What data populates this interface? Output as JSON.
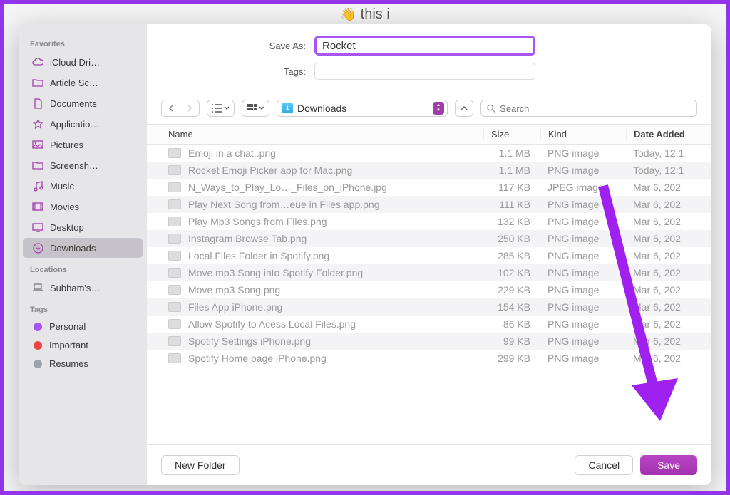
{
  "window_title": "this i",
  "window_emoji": "👋",
  "dialog": {
    "save_as_label": "Save As:",
    "save_as_value": "Rocket",
    "tags_label": "Tags:",
    "tags_value": ""
  },
  "sidebar": {
    "favorites_header": "Favorites",
    "favorites": [
      {
        "label": "iCloud Dri…",
        "icon": "cloud"
      },
      {
        "label": "Article Sc…",
        "icon": "folder"
      },
      {
        "label": "Documents",
        "icon": "document"
      },
      {
        "label": "Applicatio…",
        "icon": "apps"
      },
      {
        "label": "Pictures",
        "icon": "pictures"
      },
      {
        "label": "Screensh…",
        "icon": "folder"
      },
      {
        "label": "Music",
        "icon": "music"
      },
      {
        "label": "Movies",
        "icon": "movies"
      },
      {
        "label": "Desktop",
        "icon": "desktop"
      },
      {
        "label": "Downloads",
        "icon": "download",
        "selected": true
      }
    ],
    "locations_header": "Locations",
    "locations": [
      {
        "label": "Subham's…",
        "icon": "laptop"
      }
    ],
    "tags_header": "Tags",
    "tags": [
      {
        "label": "Personal",
        "color": "#a855f7"
      },
      {
        "label": "Important",
        "color": "#ef4444"
      },
      {
        "label": "Resumes",
        "color": "#9ca3af"
      }
    ]
  },
  "toolbar": {
    "location_label": "Downloads",
    "search_placeholder": "Search"
  },
  "columns": {
    "name": "Name",
    "size": "Size",
    "kind": "Kind",
    "date": "Date Added"
  },
  "files": [
    {
      "name": "Emoji in a chat..png",
      "size": "1.1 MB",
      "kind": "PNG image",
      "date": "Today, 12:1"
    },
    {
      "name": "Rocket Emoji Picker app for Mac.png",
      "size": "1.1 MB",
      "kind": "PNG image",
      "date": "Today, 12:1"
    },
    {
      "name": "N_Ways_to_Play_Lo…_Files_on_iPhone.jpg",
      "size": "117 KB",
      "kind": "JPEG image",
      "date": "Mar 6, 202"
    },
    {
      "name": "Play Next Song from…eue in Files app.png",
      "size": "111 KB",
      "kind": "PNG image",
      "date": "Mar 6, 202"
    },
    {
      "name": "Play Mp3 Songs from Files.png",
      "size": "132 KB",
      "kind": "PNG image",
      "date": "Mar 6, 202"
    },
    {
      "name": "Instagram Browse Tab.png",
      "size": "250 KB",
      "kind": "PNG image",
      "date": "Mar 6, 202"
    },
    {
      "name": "Local Files Folder in Spotify.png",
      "size": "285 KB",
      "kind": "PNG image",
      "date": "Mar 6, 202"
    },
    {
      "name": "Move mp3 Song into Spotify Folder.png",
      "size": "102 KB",
      "kind": "PNG image",
      "date": "Mar 6, 202"
    },
    {
      "name": "Move mp3 Song.png",
      "size": "229 KB",
      "kind": "PNG image",
      "date": "Mar 6, 202"
    },
    {
      "name": "Files App iPhone.png",
      "size": "154 KB",
      "kind": "PNG image",
      "date": "Mar 6, 202"
    },
    {
      "name": "Allow Spotify to Acess Local Files.png",
      "size": "86 KB",
      "kind": "PNG image",
      "date": "Mar 6, 202"
    },
    {
      "name": "Spotify Settings iPhone.png",
      "size": "99 KB",
      "kind": "PNG image",
      "date": "Mar 6, 202"
    },
    {
      "name": "Spotify Home page iPhone.png",
      "size": "299 KB",
      "kind": "PNG image",
      "date": "Mar 6, 202"
    }
  ],
  "footer": {
    "new_folder": "New Folder",
    "cancel": "Cancel",
    "save": "Save"
  },
  "colors": {
    "accent": "#a13daa",
    "annotation": "#a020f0"
  }
}
